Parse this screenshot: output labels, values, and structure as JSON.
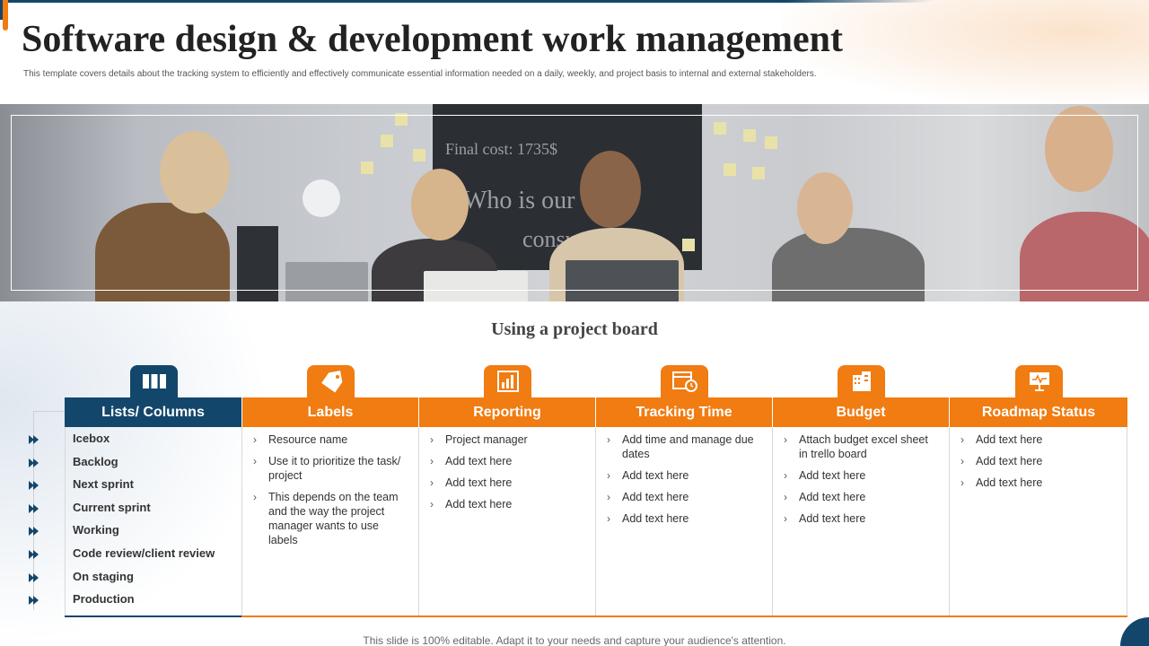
{
  "title": "Software design & development work management",
  "subtitle": "This template covers details about the tracking system to efficiently and effectively communicate essential information needed on a daily, weekly, and project basis to internal and external stakeholders.",
  "photo": {
    "board_lines": [
      "Final cost: 1735$",
      "Who is our",
      "consum"
    ]
  },
  "section_heading": "Using a project board",
  "columns": [
    {
      "header": "Lists/ Columns",
      "icon": "columns-icon",
      "color": "#13466b"
    },
    {
      "header": "Labels",
      "icon": "tag-icon",
      "color": "#f07c12",
      "items": [
        "Resource name",
        "Use it to prioritize the task/ project",
        "This depends on the team and the way the project manager wants to use labels"
      ]
    },
    {
      "header": "Reporting",
      "icon": "report-icon",
      "color": "#f07c12",
      "items": [
        "Project manager",
        "Add text here",
        "Add text here",
        "Add text here"
      ]
    },
    {
      "header": "Tracking Time",
      "icon": "calendar-clock-icon",
      "color": "#f07c12",
      "items": [
        "Add time and manage due dates",
        "Add text here",
        "Add text here",
        "Add text here"
      ]
    },
    {
      "header": "Budget",
      "icon": "budget-building-icon",
      "color": "#f07c12",
      "items": [
        "Attach budget excel sheet in trello board",
        "Add text here",
        "Add text here",
        "Add text here"
      ]
    },
    {
      "header": "Roadmap Status",
      "icon": "presentation-chart-icon",
      "color": "#f07c12",
      "items": [
        "Add text here",
        "Add text here",
        "Add text here"
      ]
    }
  ],
  "lists": [
    "Icebox",
    "Backlog",
    "Next sprint",
    "Current sprint",
    "Working",
    "Code review/client review",
    "On staging",
    "Production"
  ],
  "footer": "This slide is 100% editable. Adapt it to your needs and capture your audience's attention."
}
